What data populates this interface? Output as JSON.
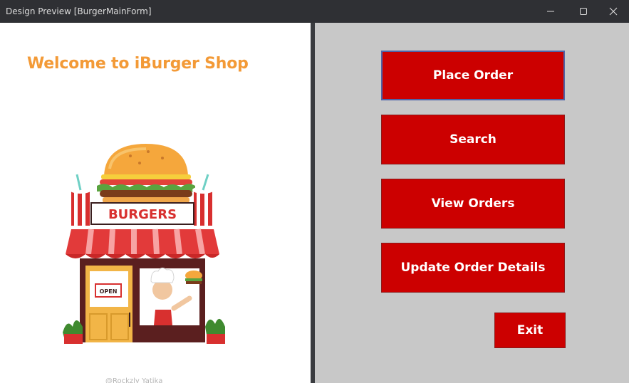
{
  "window": {
    "title": "Design Preview [BurgerMainForm]"
  },
  "left": {
    "welcome_text": "Welcome to iBurger Shop",
    "sign_text": "BURGERS",
    "door_sign": "OPEN",
    "watermark": "@Rockzly Yatika"
  },
  "buttons": {
    "place_order": "Place Order",
    "search": "Search",
    "view_orders": "View Orders",
    "update_order": "Update Order Details",
    "exit": "Exit"
  },
  "colors": {
    "button_red": "#cc0000",
    "welcome_orange": "#f39a37",
    "panel_gray": "#c8c8c8",
    "titlebar": "#2f3034"
  },
  "icons": {
    "minimize": "minimize-icon",
    "maximize": "maximize-icon",
    "close": "close-icon",
    "illustration": "burger-shop-illustration"
  }
}
